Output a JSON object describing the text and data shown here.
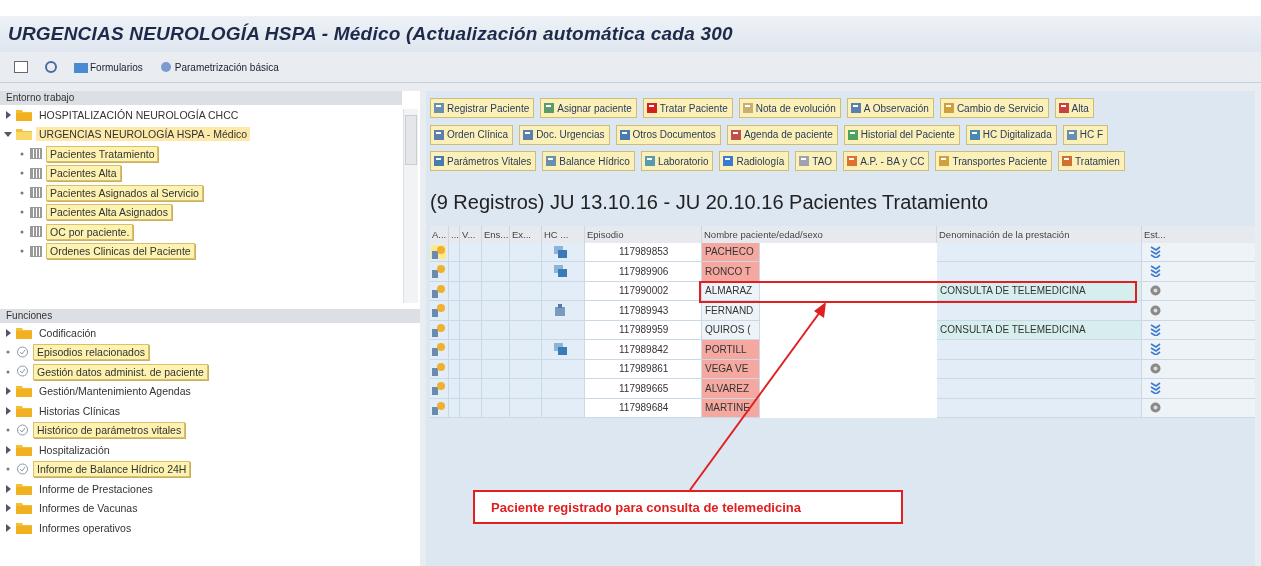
{
  "window": {
    "title": "URGENCIAS NEUROLOGÍA HSPA - Médico (Actualización automática cada 300"
  },
  "toolbar": [
    {
      "kind": "layout"
    },
    {
      "kind": "refresh"
    },
    {
      "kind": "forms",
      "label": "Formularios"
    },
    {
      "kind": "settings",
      "label": "Parametrización básica"
    }
  ],
  "work_env": {
    "title": "Entorno trabajo",
    "items": [
      {
        "label": "HOSPITALIZACIÓN NEUROLOGÍA CHCC",
        "kind": "folder",
        "expanded": false,
        "selected": false
      },
      {
        "label": "URGENCIAS NEUROLOGÍA HSPA - Médico",
        "kind": "folder",
        "expanded": true,
        "selected": true,
        "children": [
          {
            "label": "Pacientes Tratamiento",
            "kind": "table",
            "selected": false
          },
          {
            "label": "Pacientes Alta",
            "kind": "table",
            "selected": false
          },
          {
            "label": "Pacientes Asignados al Servicio",
            "kind": "table",
            "selected": false
          },
          {
            "label": "Pacientes Alta Asignados",
            "kind": "table",
            "selected": false
          },
          {
            "label": "OC por paciente.",
            "kind": "table",
            "selected": false
          },
          {
            "label": "Ordenes Clinicas del Paciente",
            "kind": "table",
            "selected": false
          }
        ]
      }
    ]
  },
  "functions": {
    "title": "Funciones",
    "items": [
      {
        "label": "Codificación",
        "kind": "folder"
      },
      {
        "label": "Episodios relacionados",
        "kind": "function"
      },
      {
        "label": "Gestión datos administ. de paciente",
        "kind": "function"
      },
      {
        "label": "Gestión/Mantenimiento Agendas",
        "kind": "folder"
      },
      {
        "label": "Historias Clínicas",
        "kind": "folder"
      },
      {
        "label": "Histórico de parámetros vitales",
        "kind": "function"
      },
      {
        "label": "Hospitalización",
        "kind": "folder"
      },
      {
        "label": "Informe de Balance Hídrico 24H",
        "kind": "function"
      },
      {
        "label": "Informe de Prestaciones",
        "kind": "folder"
      },
      {
        "label": "Informes de Vacunas",
        "kind": "folder"
      },
      {
        "label": "Informes operativos",
        "kind": "folder"
      }
    ]
  },
  "action_rows": [
    [
      "Registrar Paciente",
      "Asignar paciente",
      "Tratar Paciente",
      "Nota de evolución",
      "A Observación",
      "Cambio de Servicio",
      "Alta"
    ],
    [
      "Orden Clínica",
      "Doc. Urgencias",
      "Otros Documentos",
      "Agenda de paciente",
      "Historial del Paciente",
      "HC Digitalizada",
      "HC F"
    ],
    [
      "Parámetros Vitales",
      "Balance Hídrico",
      "Laboratorio",
      "Radiología",
      "TAO",
      "A.P. - BA y CC",
      "Transportes Paciente",
      "Tratamien"
    ]
  ],
  "table": {
    "title": "(9 Registros) JU 13.10.16 - JU 20.10.16 Pacientes Tratamiento",
    "columns": [
      "A...",
      "...",
      "V...",
      "Ens...",
      "Ex...",
      "HC ...",
      "Episodio",
      "Nombre paciente/edad/sexo",
      "Denominación de la prestación",
      "Est..."
    ],
    "rows": [
      {
        "selected": true,
        "hc": {
          "kind": "document"
        },
        "episode": "117989853",
        "name": "PACHECO",
        "flagged": true,
        "status": {
          "kind": "arrows"
        }
      },
      {
        "selected": false,
        "hc": {
          "kind": "document"
        },
        "episode": "117989906",
        "name": "RONCO T",
        "flagged": true,
        "status": {
          "kind": "arrows"
        }
      },
      {
        "selected": false,
        "episode": "117990002",
        "name": "ALMARAZ",
        "flagged": false,
        "service": "CONSULTA DE TELEMEDICINA",
        "status": {
          "kind": "circle"
        }
      },
      {
        "selected": false,
        "hc": {
          "kind": "building"
        },
        "episode": "117989943",
        "name": "FERNAND",
        "flagged": false,
        "status": {
          "kind": "circle"
        }
      },
      {
        "selected": false,
        "episode": "117989959",
        "name": "QUIROS (",
        "flagged": false,
        "service": "CONSULTA DE TELEMEDICINA",
        "status": {
          "kind": "arrows"
        }
      },
      {
        "selected": false,
        "hc": {
          "kind": "document"
        },
        "episode": "117989842",
        "name": "PORTILL",
        "flagged": true,
        "status": {
          "kind": "arrows"
        }
      },
      {
        "selected": false,
        "episode": "117989861",
        "name": "VEGA VE",
        "flagged": true,
        "status": {
          "kind": "circle"
        }
      },
      {
        "selected": false,
        "episode": "117989665",
        "name": "ALVAREZ",
        "flagged": true,
        "status": {
          "kind": "arrows"
        }
      },
      {
        "selected": false,
        "episode": "117989684",
        "name": "MARTINE",
        "flagged": true,
        "status": {
          "kind": "circle"
        }
      }
    ]
  },
  "annotation": {
    "text": "Paciente registrado para consulta de telemedicina"
  }
}
